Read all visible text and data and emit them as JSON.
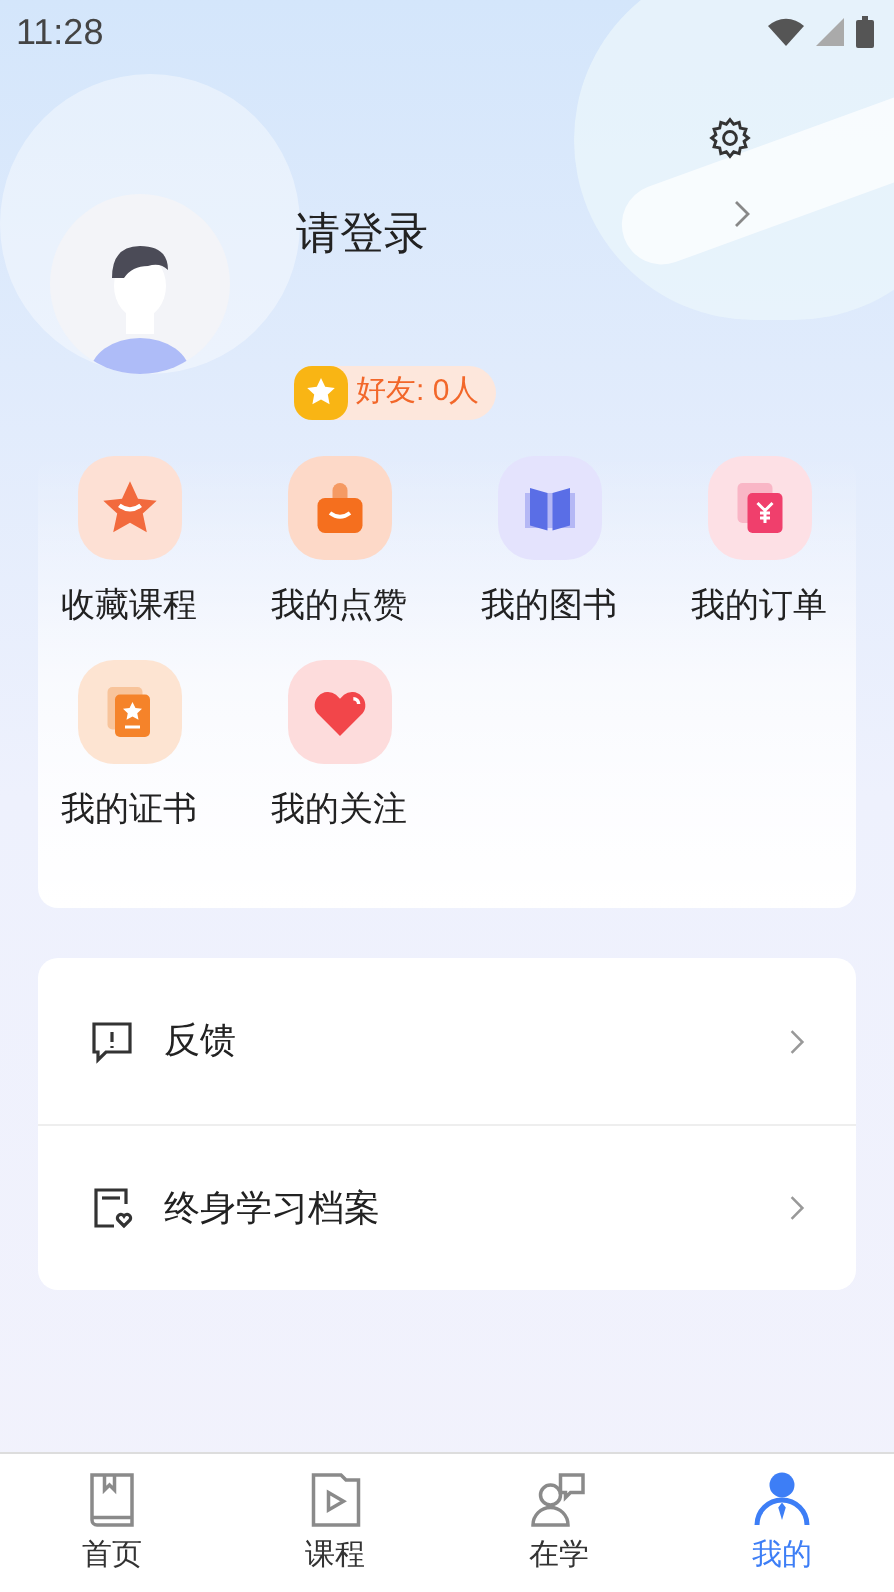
{
  "status_bar": {
    "time": "11:28"
  },
  "profile": {
    "name": "请登录",
    "badge": "好友: 0人"
  },
  "shortcuts": [
    {
      "kind": "star",
      "label": "收藏课程"
    },
    {
      "kind": "thumb",
      "label": "我的点赞"
    },
    {
      "kind": "book",
      "label": "我的图书"
    },
    {
      "kind": "order",
      "label": "我的订单"
    },
    {
      "kind": "certificate",
      "label": "我的证书"
    },
    {
      "kind": "heart",
      "label": "我的关注"
    }
  ],
  "menu": [
    {
      "kind": "feedback",
      "label": "反馈"
    },
    {
      "kind": "archive",
      "label": "终身学习档案"
    }
  ],
  "tabs": [
    {
      "kind": "home",
      "label": "首页",
      "selected": false
    },
    {
      "kind": "course",
      "label": "课程",
      "selected": false
    },
    {
      "kind": "study",
      "label": "在学",
      "selected": false
    },
    {
      "kind": "mine",
      "label": "我的",
      "selected": true
    }
  ]
}
